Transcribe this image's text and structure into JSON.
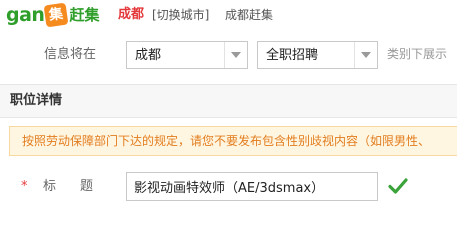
{
  "header": {
    "logo_text": "gan",
    "logo_badge": "集",
    "logo_brand": "赶集",
    "city": "成都",
    "switch_city": "[切换城市]",
    "city_site": "成都赶集"
  },
  "publish": {
    "label": "信息将在",
    "city_select": "成都",
    "category_select": "全职招聘",
    "hint": "类别下展示"
  },
  "section": {
    "title": "职位详情"
  },
  "notice": {
    "text": "按照劳动保障部门下达的规定，请您不要发布包含性别歧视内容（如限男性、"
  },
  "form": {
    "required_mark": "*",
    "title_label": "标题",
    "title_value": "影视动画特效师（AE/3dsmax）"
  },
  "colors": {
    "brand_green": "#2f9e2a",
    "brand_orange": "#f58a1f",
    "city_red": "#e4393c",
    "notice_text": "#e27d1f",
    "notice_bg": "#fff6e1",
    "check_green": "#3aa33a"
  },
  "icons": {
    "dropdown": "chevron-down-icon",
    "valid": "check-icon"
  }
}
